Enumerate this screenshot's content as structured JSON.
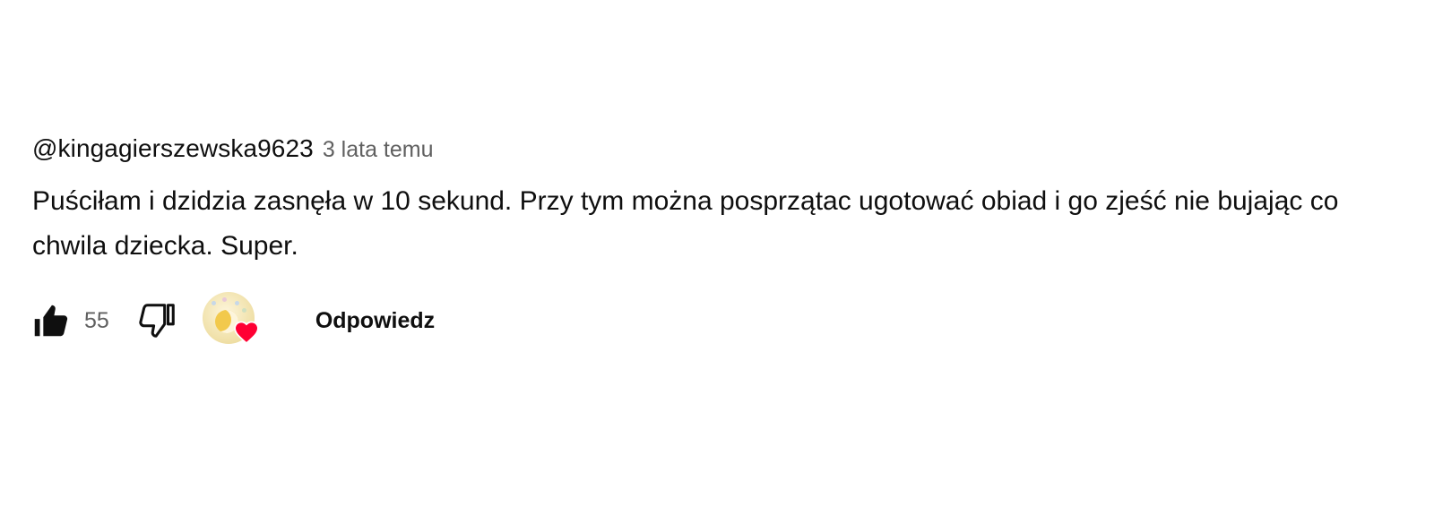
{
  "comment": {
    "author": "@kingagierszewska9623",
    "timestamp": "3 lata temu",
    "text": "Puściłam i dzidzia zasnęła w 10 sekund. Przy tym można posprzątac ugotować obiad i go zjeść nie bujając co chwila dziecka. Super."
  },
  "actions": {
    "like_icon": "thumbs-up-icon",
    "like_count": "55",
    "dislike_icon": "thumbs-down-icon",
    "creator_heart_icon": "creator-heart-icon",
    "reply_label": "Odpowiedz"
  },
  "colors": {
    "text_primary": "#0f0f0f",
    "text_secondary": "#606060",
    "heart": "#ff0033"
  }
}
